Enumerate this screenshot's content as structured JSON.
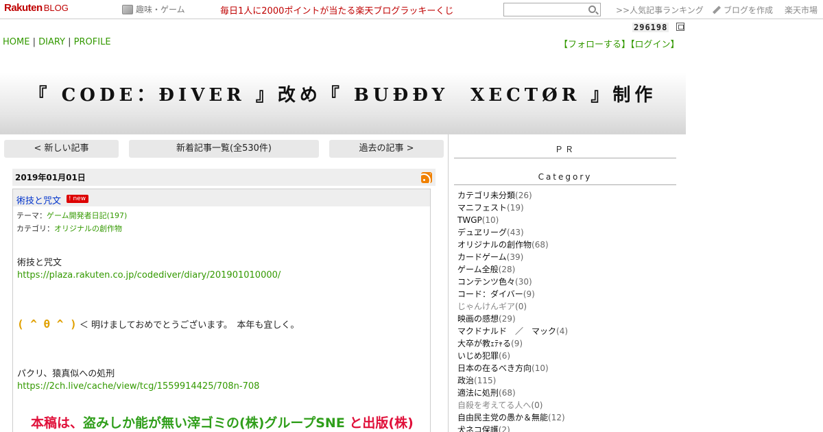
{
  "topbar": {
    "logo_main": "Rakuten",
    "logo_sub": "BLOG",
    "genre": "趣味・ゲーム",
    "lucky": "毎日1人に2000ポイントが当たる楽天ブログラッキーくじ",
    "search_placeholder": "",
    "ranking": ">>人気記事ランキング",
    "make_blog": "ブログを作成",
    "ichiba": "楽天市場"
  },
  "counter": "296198",
  "nav": {
    "home": "HOME",
    "diary": "DIARY",
    "profile": "PROFILE",
    "sep": " | ",
    "follow": "【フォローする】",
    "login": "【ログイン】"
  },
  "blog_title": "『 CODE：ÐIVER 』改め『 BUÐÐY　XECTØR 』制作",
  "pager": {
    "newer": "< 新しい記事",
    "list": "新着記事一覧(全530件)",
    "older": "過去の記事 >"
  },
  "article": {
    "date": "2019年01月01日",
    "title": "術技と咒文",
    "new_badge": "new",
    "theme_label": "テーマ：",
    "theme_value": "ゲーム開発者日記(197)",
    "category_label": "カテゴリ：",
    "category_value": "オリジナルの創作物",
    "line1": "術技と咒文",
    "link1": "https://plaza.rakuten.co.jp/codediver/diary/201901010000/",
    "kaomoji": "( ^ θ ^ )",
    "greeting": "＜ 明けましておめでとうございます。　本年も宜しく。",
    "line4": "パクリ、猿真似への処刑",
    "link2": "https://2ch.live/cache/view/tcg/1559914425/708n-708",
    "big_part1": "本稿は、",
    "big_part2": "盗みしか能が無い滓ゴミの(株)グループSNE",
    "big_part3": " と出版(株)"
  },
  "sidebar": {
    "pr": "ＰＲ",
    "category_head": "Category",
    "categories": [
      {
        "name": "カテゴリ未分類",
        "count": "(26)"
      },
      {
        "name": "マニフェスト",
        "count": "(19)"
      },
      {
        "name": "TWGP",
        "count": "(10)"
      },
      {
        "name": "デュヱリーグ",
        "count": "(43)"
      },
      {
        "name": "オリジナルの創作物",
        "count": "(68)"
      },
      {
        "name": "カードゲーム",
        "count": "(39)"
      },
      {
        "name": "ゲーム全般",
        "count": "(28)"
      },
      {
        "name": "コンテンツ色々",
        "count": "(30)"
      },
      {
        "name": "コード：ダイバー",
        "count": "(9)"
      },
      {
        "name": "じゃんけんギア",
        "count": "(0)"
      },
      {
        "name": "映画の感想",
        "count": "(29)"
      },
      {
        "name": "マクドナルド　／　マック",
        "count": "(4)"
      },
      {
        "name": "大卒が教ｪﾃｬる",
        "count": "(9)"
      },
      {
        "name": "いじめ犯罪",
        "count": "(6)"
      },
      {
        "name": "日本の在るべき方向",
        "count": "(10)"
      },
      {
        "name": "政治",
        "count": "(115)"
      },
      {
        "name": "適法に処刑",
        "count": "(68)"
      },
      {
        "name": "自殺を考えてる人へ",
        "count": "(0)"
      },
      {
        "name": "自由民主党の愚か＆無能",
        "count": "(12)"
      },
      {
        "name": "犬ネコ保護",
        "count": "(2)"
      }
    ]
  }
}
